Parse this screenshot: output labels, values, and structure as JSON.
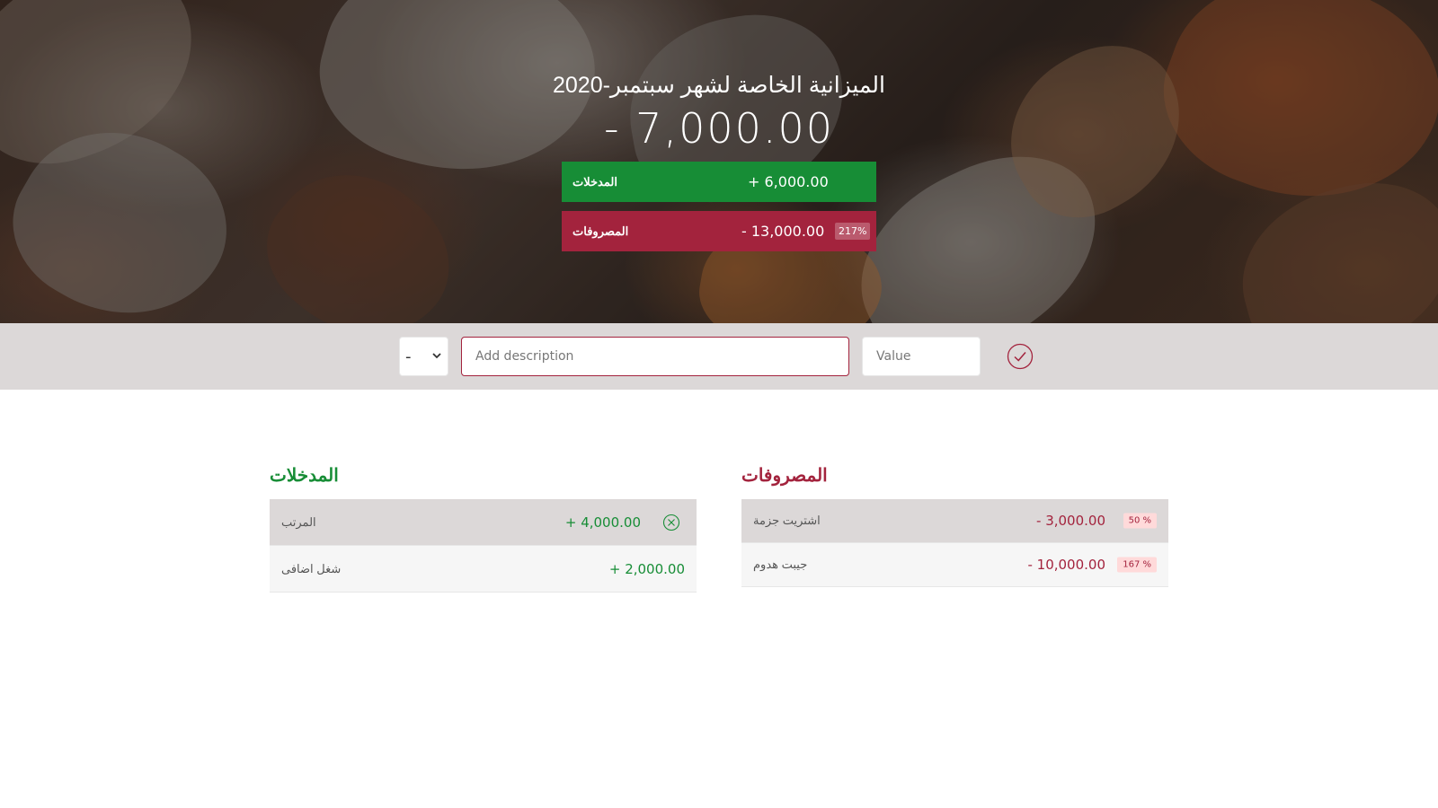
{
  "header": {
    "budget_title": "الميزانية الخاصة لشهر سبتمبر-2020",
    "budget_value": "- 7,000.00",
    "income_label": "المدخلات",
    "income_value": "+ 6,000.00",
    "expenses_label": "المصروفات",
    "expenses_value": "- 13,000.00",
    "expenses_percentage": "217%"
  },
  "add_bar": {
    "type_selected": "-",
    "description_placeholder": "Add description",
    "value_placeholder": "Value",
    "submit_icon": "check-circle-icon"
  },
  "income": {
    "title": "المدخلات",
    "items": [
      {
        "description": "المرتب",
        "value": "+ 4,000.00"
      },
      {
        "description": "شغل اضافى",
        "value": "+ 2,000.00"
      }
    ]
  },
  "expenses": {
    "title": "المصروفات",
    "items": [
      {
        "description": "اشتريت جزمة",
        "value": "- 3,000.00",
        "percentage": "50 %"
      },
      {
        "description": "جيبت هدوم",
        "value": "- 10,000.00",
        "percentage": "167 %"
      }
    ]
  },
  "colors": {
    "income": "#178d36",
    "expenses": "#a3233d",
    "add_bar": "#dcd8d8"
  }
}
